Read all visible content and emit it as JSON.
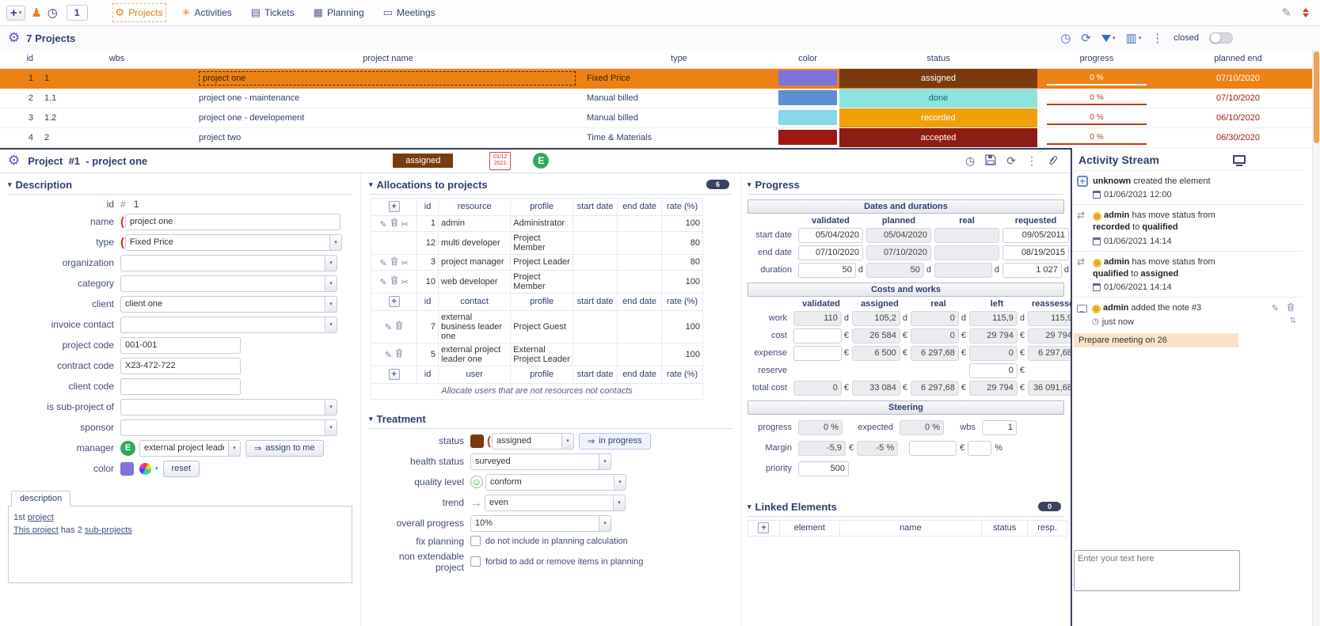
{
  "colors": {
    "accent_orange": "#ec8216",
    "navy": "#2e3f6e",
    "status_assigned": "#7b3a0e",
    "status_done": "#8fe3df",
    "status_recorded": "#f2a007",
    "status_accepted": "#8c1d14"
  },
  "units": {
    "d": "d",
    "eur": "€",
    "pct": "%"
  },
  "topbar": {
    "count": "1",
    "tabs": [
      {
        "label": "Projects"
      },
      {
        "label": "Activities"
      },
      {
        "label": "Tickets"
      },
      {
        "label": "Planning"
      },
      {
        "label": "Meetings"
      }
    ]
  },
  "projects": {
    "title": "7 Projects",
    "closed_label": "closed",
    "columns": {
      "id": "id",
      "wbs": "wbs",
      "name": "project name",
      "type": "type",
      "color": "color",
      "status": "status",
      "progress": "progress",
      "planned_end": "planned end"
    },
    "rows": [
      {
        "id": "1",
        "wbs": "1",
        "name": "project one",
        "type": "Fixed Price",
        "color": "#7d72e0",
        "status": "assigned",
        "status_bg": "#7b3a0e",
        "status_fg": "#ffffff",
        "progress": "0 %",
        "planned_end": "07/10/2020"
      },
      {
        "id": "2",
        "wbs": "1.1",
        "name": "project one - maintenance",
        "type": "Manual billed",
        "color": "#5d8fd3",
        "status": "done",
        "status_bg": "#8fe3df",
        "status_fg": "#0d6e6e",
        "progress": "0 %",
        "planned_end": "07/10/2020"
      },
      {
        "id": "3",
        "wbs": "1.2",
        "name": "project one - developement",
        "type": "Manual billed",
        "color": "#86d8ea",
        "status": "recorded",
        "status_bg": "#f2a007",
        "status_fg": "#ffffff",
        "progress": "0 %",
        "planned_end": "06/10/2020"
      },
      {
        "id": "4",
        "wbs": "2",
        "name": "project two",
        "type": "Time & Materials",
        "color": "#a01713",
        "status": "accepted",
        "status_bg": "#8c1d14",
        "status_fg": "#ffffff",
        "progress": "0 %",
        "planned_end": "06/30/2020"
      }
    ]
  },
  "detail": {
    "entity": "Project",
    "number": "#1",
    "name": "- project one",
    "status_badge": "assigned",
    "stamp_top": "01/12",
    "stamp_bottom": "2021",
    "manager_initial": "E"
  },
  "description": {
    "title": "Description",
    "id_label": "id",
    "id_hash": "#",
    "id_value": "1",
    "fields": {
      "name": {
        "label": "name",
        "value": "project one"
      },
      "type": {
        "label": "type",
        "value": "Fixed Price"
      },
      "organization": {
        "label": "organization",
        "value": ""
      },
      "category": {
        "label": "category",
        "value": ""
      },
      "client": {
        "label": "client",
        "value": "client one"
      },
      "invoice_contact": {
        "label": "invoice contact",
        "value": ""
      },
      "project_code": {
        "label": "project code",
        "value": "001-001"
      },
      "contract_code": {
        "label": "contract code",
        "value": "X23-472-722"
      },
      "client_code": {
        "label": "client code",
        "value": ""
      },
      "sub_project": {
        "label": "is sub-project of",
        "value": ""
      },
      "sponsor": {
        "label": "sponsor",
        "value": ""
      },
      "manager": {
        "label": "manager",
        "value": "external project leader"
      },
      "color": {
        "label": "color"
      }
    },
    "assign_to_me": "assign to me",
    "reset": "reset",
    "tab": "description",
    "desc_line1_pre": "1st ",
    "desc_line1_link": "project",
    "desc_line2_link1": "This project",
    "desc_line2_mid": " has 2 ",
    "desc_line2_link2": "sub-projects"
  },
  "allocations": {
    "title": "Allocations to projects",
    "badge": "6",
    "headers": {
      "id": "id",
      "resource": "resource",
      "contact": "contact",
      "user": "user",
      "profile": "profile",
      "start": "start date",
      "end": "end date",
      "rate": "rate (%)"
    },
    "resources": [
      {
        "id": "1",
        "name": "admin",
        "profile": "Administrator",
        "start": "",
        "end": "",
        "rate": "100"
      },
      {
        "id": "12",
        "name": "multi developer",
        "profile": "Project Member",
        "start": "",
        "end": "",
        "rate": "80"
      },
      {
        "id": "3",
        "name": "project manager",
        "profile": "Project Leader",
        "start": "",
        "end": "",
        "rate": "80"
      },
      {
        "id": "10",
        "name": "web developer",
        "profile": "Project Member",
        "start": "",
        "end": "",
        "rate": "100"
      }
    ],
    "contacts": [
      {
        "id": "7",
        "name": "external business leader one",
        "profile": "Project Guest",
        "start": "",
        "end": "",
        "rate": "100"
      },
      {
        "id": "5",
        "name": "external project leader one",
        "profile": "External Project Leader",
        "start": "",
        "end": "",
        "rate": "100"
      }
    ],
    "footnote": "Allocate users that are not resources not contacts"
  },
  "treatment": {
    "title": "Treatment",
    "status_label": "status",
    "status_value": "assigned",
    "in_progress": "in progress",
    "health_label": "health status",
    "health_value": "surveyed",
    "quality_label": "quality level",
    "quality_value": "conform",
    "trend_label": "trend",
    "trend_value": "even",
    "overall_label": "overall progress",
    "overall_value": "10%",
    "fix_label": "fix planning",
    "fix_text": "do not include in planning calculation",
    "nonext_label": "non extendable project",
    "nonext_text": "forbid to add or remove items in planning"
  },
  "progress": {
    "title": "Progress",
    "dates": {
      "bar": "Dates and durations",
      "cols": [
        "validated",
        "planned",
        "real",
        "requested"
      ],
      "start": {
        "label": "start date",
        "validated": "05/04/2020",
        "planned": "05/04/2020",
        "real": "",
        "requested": "09/05/2011"
      },
      "end": {
        "label": "end date",
        "validated": "07/10/2020",
        "planned": "07/10/2020",
        "real": "",
        "requested": "08/19/2015"
      },
      "duration": {
        "label": "duration",
        "validated": "50",
        "planned": "50",
        "real": "",
        "requested": "1 027"
      }
    },
    "costs": {
      "bar": "Costs and works",
      "cols": [
        "validated",
        "assigned",
        "real",
        "left",
        "reassessed"
      ],
      "work": {
        "label": "work",
        "validated": "110",
        "assigned": "105,2",
        "real": "0",
        "left": "115,9",
        "reassessed": "115,9"
      },
      "cost": {
        "label": "cost",
        "validated": "",
        "assigned": "26 584",
        "real": "0",
        "left": "29 794",
        "reassessed": "29 794"
      },
      "expense": {
        "label": "expense",
        "validated": "",
        "assigned": "6 500",
        "real": "6 297,68",
        "left": "0",
        "reassessed": "6 297,68"
      },
      "reserve": {
        "label": "reserve",
        "left": "0"
      },
      "total": {
        "label": "total cost",
        "validated": "0",
        "assigned": "33 084",
        "real": "6 297,68",
        "left": "29 794",
        "reassessed": "36 091,68"
      }
    },
    "steering": {
      "bar": "Steering",
      "progress_label": "progress",
      "progress": "0 %",
      "expected_label": "expected",
      "expected": "0 %",
      "wbs_label": "wbs",
      "wbs": "1",
      "margin_label": "Margin",
      "margin_eur": "-5,9",
      "margin_pct": "-5 %",
      "priority_label": "priority",
      "priority": "500"
    }
  },
  "linked": {
    "title": "Linked Elements",
    "badge": "0",
    "cols": [
      "element",
      "name",
      "status",
      "resp."
    ]
  },
  "activity": {
    "title": "Activity Stream",
    "entries": [
      {
        "user": "unknown",
        "text": " created the element",
        "time": "01/06/2021 12:00"
      },
      {
        "user": "admin",
        "t1": " has move status from ",
        "from": "recorded",
        "t2": " to ",
        "to": "qualified",
        "time": "01/06/2021 14:14"
      },
      {
        "user": "admin",
        "t1": " has move status from ",
        "from": "qualified",
        "t2": " to ",
        "to": "assigned",
        "time": "01/06/2021 14:14"
      },
      {
        "user": "admin",
        "text": " added the note #3",
        "time": "just now"
      }
    ],
    "note": "Prepare meeting on 26",
    "placeholder": "Enter your text here"
  }
}
